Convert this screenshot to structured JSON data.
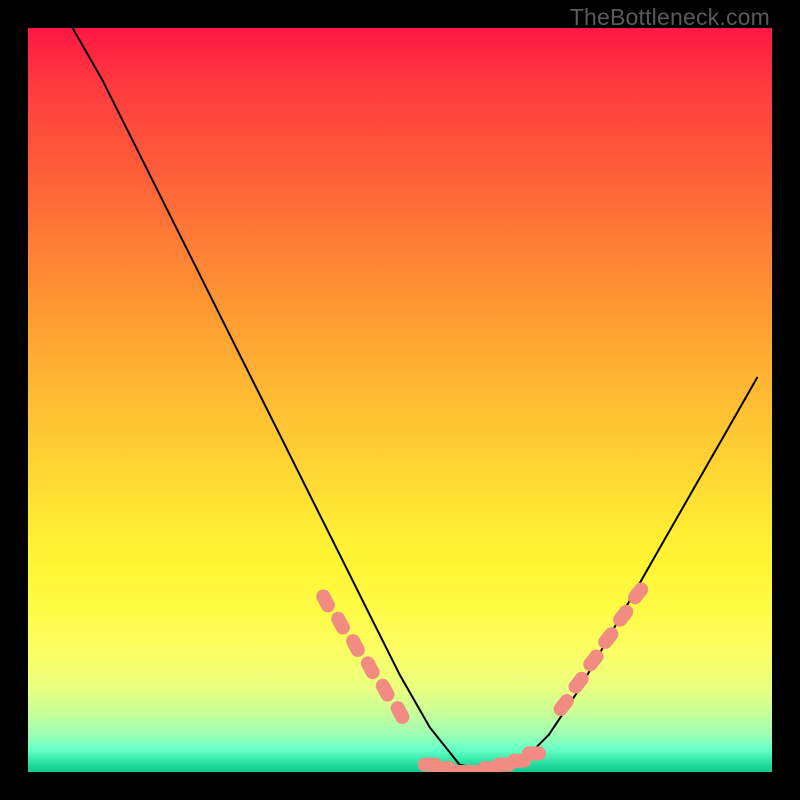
{
  "watermark": "TheBottleneck.com",
  "colors": {
    "frame": "#000000",
    "gradient_top": "#ff1744",
    "gradient_mid": "#ffe933",
    "gradient_bottom": "#12c98e",
    "curve": "#000000",
    "marker": "#f28b82"
  },
  "chart_data": {
    "type": "line",
    "title": "",
    "xlabel": "",
    "ylabel": "",
    "xlim": [
      0,
      100
    ],
    "ylim": [
      0,
      100
    ],
    "x": [
      6,
      10,
      14,
      18,
      22,
      26,
      30,
      34,
      38,
      42,
      46,
      50,
      54,
      58,
      62,
      66,
      70,
      74,
      78,
      82,
      86,
      90,
      94,
      98
    ],
    "values": [
      100,
      93,
      85,
      77,
      69,
      61,
      53,
      45,
      37,
      29,
      21,
      13,
      6,
      1,
      0,
      1,
      5,
      11,
      18,
      25,
      32,
      39,
      46,
      53
    ],
    "annotations": {
      "left_band_x": [
        40,
        42,
        44,
        46,
        48,
        50
      ],
      "left_band_y": [
        23,
        20,
        17,
        14,
        11,
        8
      ],
      "trough_x": [
        54,
        56,
        58,
        60,
        62,
        64,
        66,
        68
      ],
      "trough_y": [
        1,
        0.5,
        0,
        0,
        0.5,
        1,
        1.5,
        2.5
      ],
      "right_band_x": [
        72,
        74,
        76,
        78,
        80,
        82
      ],
      "right_band_y": [
        9,
        12,
        15,
        18,
        21,
        24
      ]
    }
  }
}
